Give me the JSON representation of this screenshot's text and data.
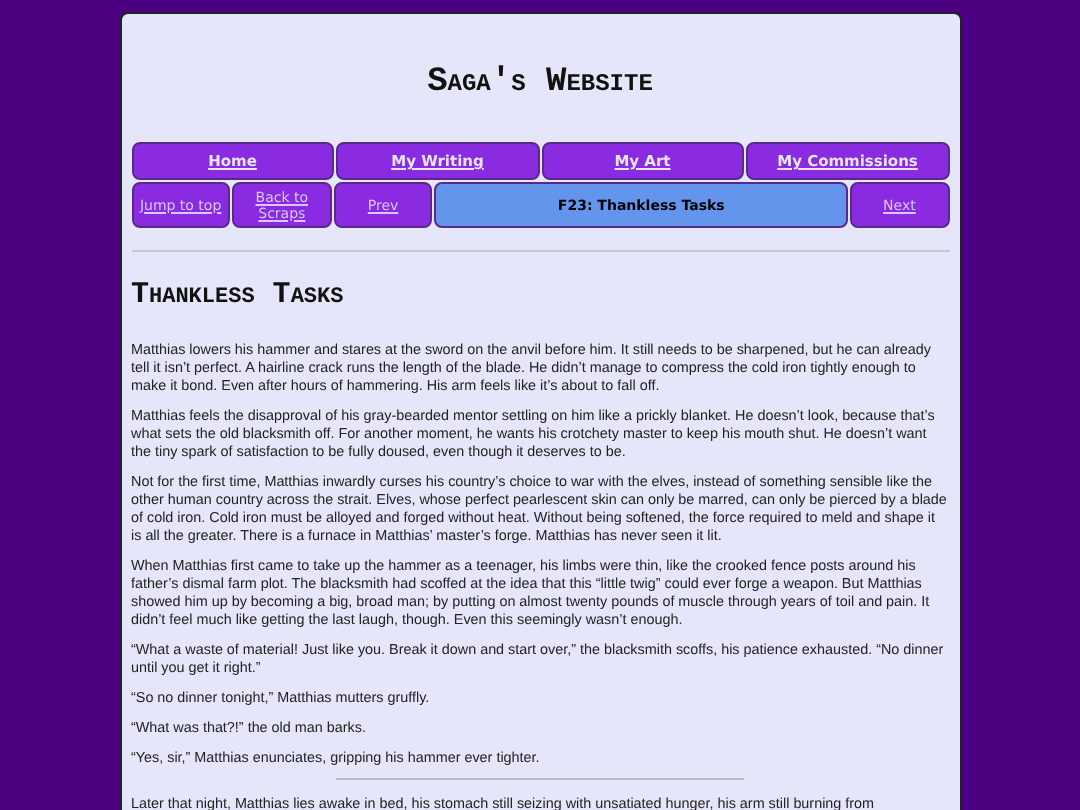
{
  "site_title": "Saga's Website",
  "nav_rows": [
    {
      "items": [
        {
          "label": "Home",
          "selected": false
        },
        {
          "label": "My Writing",
          "selected": false
        },
        {
          "label": "My Art",
          "selected": false
        },
        {
          "label": "My Commissions",
          "selected": false
        }
      ]
    },
    {
      "items": [
        {
          "label": "Jump to top",
          "selected": false
        },
        {
          "label": "Back to Scraps",
          "selected": false
        },
        {
          "label": "Prev",
          "selected": false
        },
        {
          "label": "F23: Thankless Tasks",
          "selected": true
        },
        {
          "label": "Next",
          "selected": false
        }
      ]
    }
  ],
  "story": {
    "title": "Thankless Tasks",
    "blocks": [
      {
        "kind": "paragraph",
        "text": "Matthias lowers his hammer and stares at the sword on the anvil before him. It still needs to be sharpened, but he can already tell it isn’t perfect. A hairline crack runs the length of the blade. He didn’t manage to compress the cold iron tightly enough to make it bond. Even after hours of hammering. His arm feels like it’s about to fall off."
      },
      {
        "kind": "paragraph",
        "text": "Matthias feels the disapproval of his gray-bearded mentor settling on him like a prickly blanket. He doesn’t look, because that’s what sets the old blacksmith off. For another moment, he wants his crotchety master to keep his mouth shut. He doesn’t want the tiny spark of satisfaction to be fully doused, even though it deserves to be."
      },
      {
        "kind": "paragraph",
        "text": "Not for the first time, Matthias inwardly curses his country’s choice to war with the elves, instead of something sensible like the other human country across the strait. Elves, whose perfect pearlescent skin can only be marred, can only be pierced by a blade of cold iron. Cold iron must be alloyed and forged without heat. Without being softened, the force required to meld and shape it is all the greater. There is a furnace in Matthias’ master’s forge. Matthias has never seen it lit."
      },
      {
        "kind": "paragraph",
        "text": "When Matthias first came to take up the hammer as a teenager, his limbs were thin, like the crooked fence posts around his father’s dismal farm plot. The blacksmith had scoffed at the idea that this “little twig” could ever forge a weapon. But Matthias showed him up by becoming a big, broad man; by putting on almost twenty pounds of muscle through years of toil and pain. It didn’t feel much like getting the last laugh, though. Even this seemingly wasn’t enough."
      },
      {
        "kind": "paragraph",
        "text": "“What a waste of material! Just like you. Break it down and start over,” the blacksmith scoffs, his patience exhausted. “No dinner until you get it right.”"
      },
      {
        "kind": "paragraph",
        "text": "“So no dinner tonight,” Matthias mutters gruffly."
      },
      {
        "kind": "paragraph",
        "text": "“What was that?!” the old man barks."
      },
      {
        "kind": "paragraph",
        "text": "“Yes, sir,” Matthias enunciates, gripping his hammer ever tighter."
      },
      {
        "kind": "scene-break"
      },
      {
        "kind": "paragraph",
        "text": "Later that night, Matthias lies awake in bed, his stomach still seizing with unsatiated hunger, his arm still burning from"
      }
    ]
  }
}
